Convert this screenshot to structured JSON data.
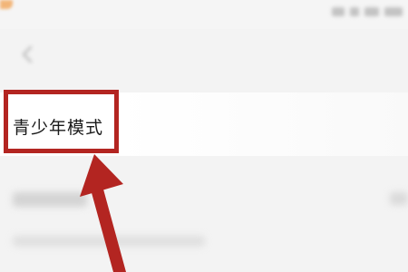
{
  "settings": {
    "teen_mode_label": "青少年模式"
  },
  "annotation": {
    "highlight_color": "#b32521",
    "arrow_color": "#b32521"
  },
  "icons": {
    "back": "back-arrow-icon"
  }
}
